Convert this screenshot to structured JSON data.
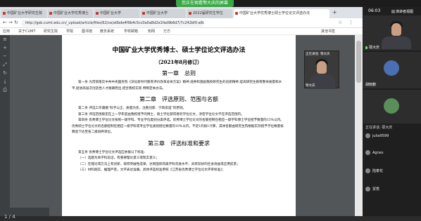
{
  "meeting": {
    "share_banner": "您正在观看鄂大庆的屏幕",
    "clock": "06:03",
    "recording_label": "演讲者视图"
  },
  "browser": {
    "tabs": [
      {
        "label": "中国矿业大学研究生院"
      },
      {
        "label": "中国矿业大学优秀博士"
      },
      {
        "label": "中国矿业大学"
      },
      {
        "label": "中国矿业大学"
      },
      {
        "label": "2022届研究生学位"
      },
      {
        "label": "中国矿业大学优秀博士硕士学位论文评选办法"
      }
    ],
    "new_tab": "+",
    "url": "http://gsb.cumt.edu.cn/_upload/article/files/62/ce/a0bde4f9b4c5cc0a0a8d2e1fad9b6d7/7c242bf0-a60a4d7-8c42d2d7-8b5a0-5b1e89c78d2.pdf",
    "bookmarks": [
      "应用",
      "关于CUMT",
      "研究生院",
      "学院",
      "图书馆",
      "教务系统",
      "学校邮箱",
      "知网",
      "万方",
      "其他书签"
    ]
  },
  "document": {
    "title": "中国矿业大学优秀博士、硕士学位论文评选办法",
    "subtitle": "（2021年8月修订）",
    "chapter1": "第一章　总则",
    "art1": "第一条 为贯彻落实中共中央国务院《深化新时代教育评价改革总体方案》精神,培养和激励我校研究生的创新精神,提高研究生教育整体质量和水平,促进高层次创造性人才脱颖而出,结合我校实际,特制定本办法。",
    "chapter2": "第二章　评选原则、范围与名额",
    "art2": "第二条 评选工作遵循“科学公正、质量为先、注重创新、宁缺毋滥”的原则。",
    "art3": "第三条 评选范围限定在上一学年度由我校授予的博士、硕士学位获得者的学位论文，涉密学位论文不在评选范围内。",
    "art4": "第四条 优秀博士学位论文按照一级学科、专业学位类别分类评选。优秀博士学位论文的名额控制在相应一级学科博士学位授予数量的15%以内。优秀硕士学位论文的名额控制在相应一级学科或专业学位类别授位数量的10%以内，不足1的按1计算，其体名额由研究生院根据实际授予学位数量核算后下达至各二级培养单位。",
    "chapter3": "第三章　评选标准和要求",
    "art5": "第五条 优秀博士学位论文评选应依据以下标准:",
    "item1": "（一）选题为本学科前沿，有重要理论意义或现实意义；",
    "item2": "（二）在理论或方法上有创新，取得突破性成果，达到国际同类学科先进水平，具有较好的社会效益或应用前景；",
    "item3": "（三）材料翔实、推理严密，文字表达准确。具体评选标准参照《江苏省优秀博士学位论文评审标准》；"
  },
  "participants": {
    "main_speaker": "鄂大庆",
    "overlay_label": "正在讲话: 鄂大庆",
    "overlay_name": "鄂大庆",
    "tiles": [
      "胡晓鹏"
    ],
    "list_title": "正在讲话: 鄂大庆",
    "list": [
      "julia9599",
      "Agnes",
      "陆泰花",
      "贾秀"
    ]
  },
  "viewer": {
    "page_indicator": "1 / 4"
  }
}
